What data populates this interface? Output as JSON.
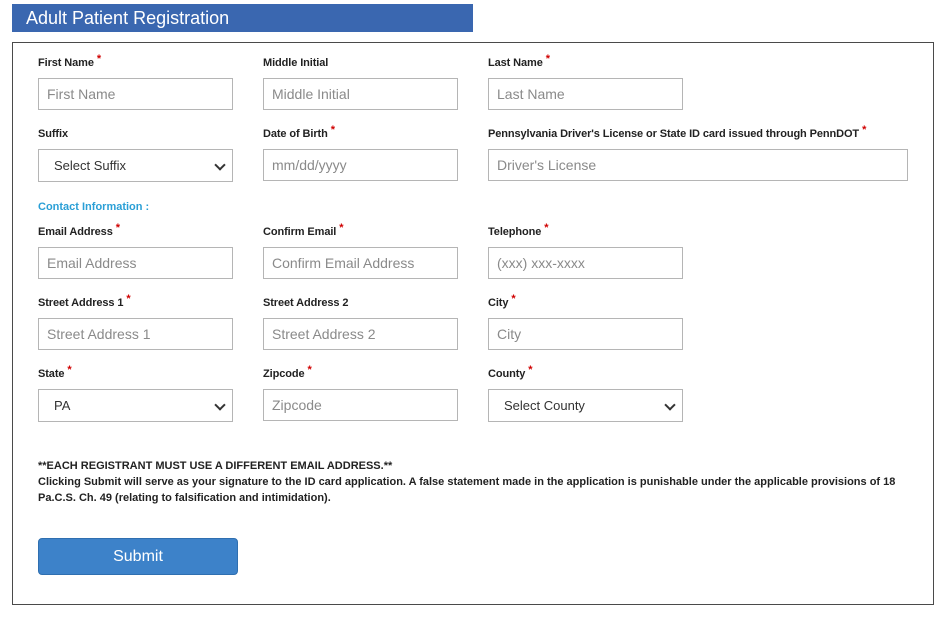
{
  "header": {
    "title": "Adult Patient Registration"
  },
  "form": {
    "first_name": {
      "label": "First Name",
      "placeholder": "First Name"
    },
    "middle_initial": {
      "label": "Middle Initial",
      "placeholder": "Middle Initial"
    },
    "last_name": {
      "label": "Last Name",
      "placeholder": "Last Name"
    },
    "suffix": {
      "label": "Suffix",
      "value": "Select Suffix"
    },
    "dob": {
      "label": "Date of Birth",
      "placeholder": "mm/dd/yyyy"
    },
    "license": {
      "label": "Pennsylvania Driver's License or State ID card issued through PennDOT",
      "placeholder": "Driver's License"
    },
    "contact_section": "Contact Information :",
    "email": {
      "label": "Email Address",
      "placeholder": "Email Address"
    },
    "confirm_email": {
      "label": "Confirm Email",
      "placeholder": "Confirm Email Address"
    },
    "telephone": {
      "label": "Telephone",
      "placeholder": "(xxx) xxx-xxxx"
    },
    "street1": {
      "label": "Street Address 1",
      "placeholder": "Street Address 1"
    },
    "street2": {
      "label": "Street Address 2",
      "placeholder": "Street Address 2"
    },
    "city": {
      "label": "City",
      "placeholder": "City"
    },
    "state": {
      "label": "State",
      "value": "PA"
    },
    "zipcode": {
      "label": "Zipcode",
      "placeholder": "Zipcode"
    },
    "county": {
      "label": "County",
      "value": "Select County"
    },
    "required_marker": "*",
    "notice_line1": "**EACH REGISTRANT MUST USE A DIFFERENT EMAIL ADDRESS.**",
    "notice_line2": "Clicking Submit will serve as your signature to the ID card application. A false statement made in the application is punishable under the applicable provisions of 18 Pa.C.S. Ch. 49 (relating to falsification and intimidation).",
    "submit_label": "Submit"
  },
  "colors": {
    "header_bg": "#3a67b0",
    "required": "#d00000",
    "section_title": "#2a9fd6",
    "submit_bg": "#3d82c9"
  }
}
